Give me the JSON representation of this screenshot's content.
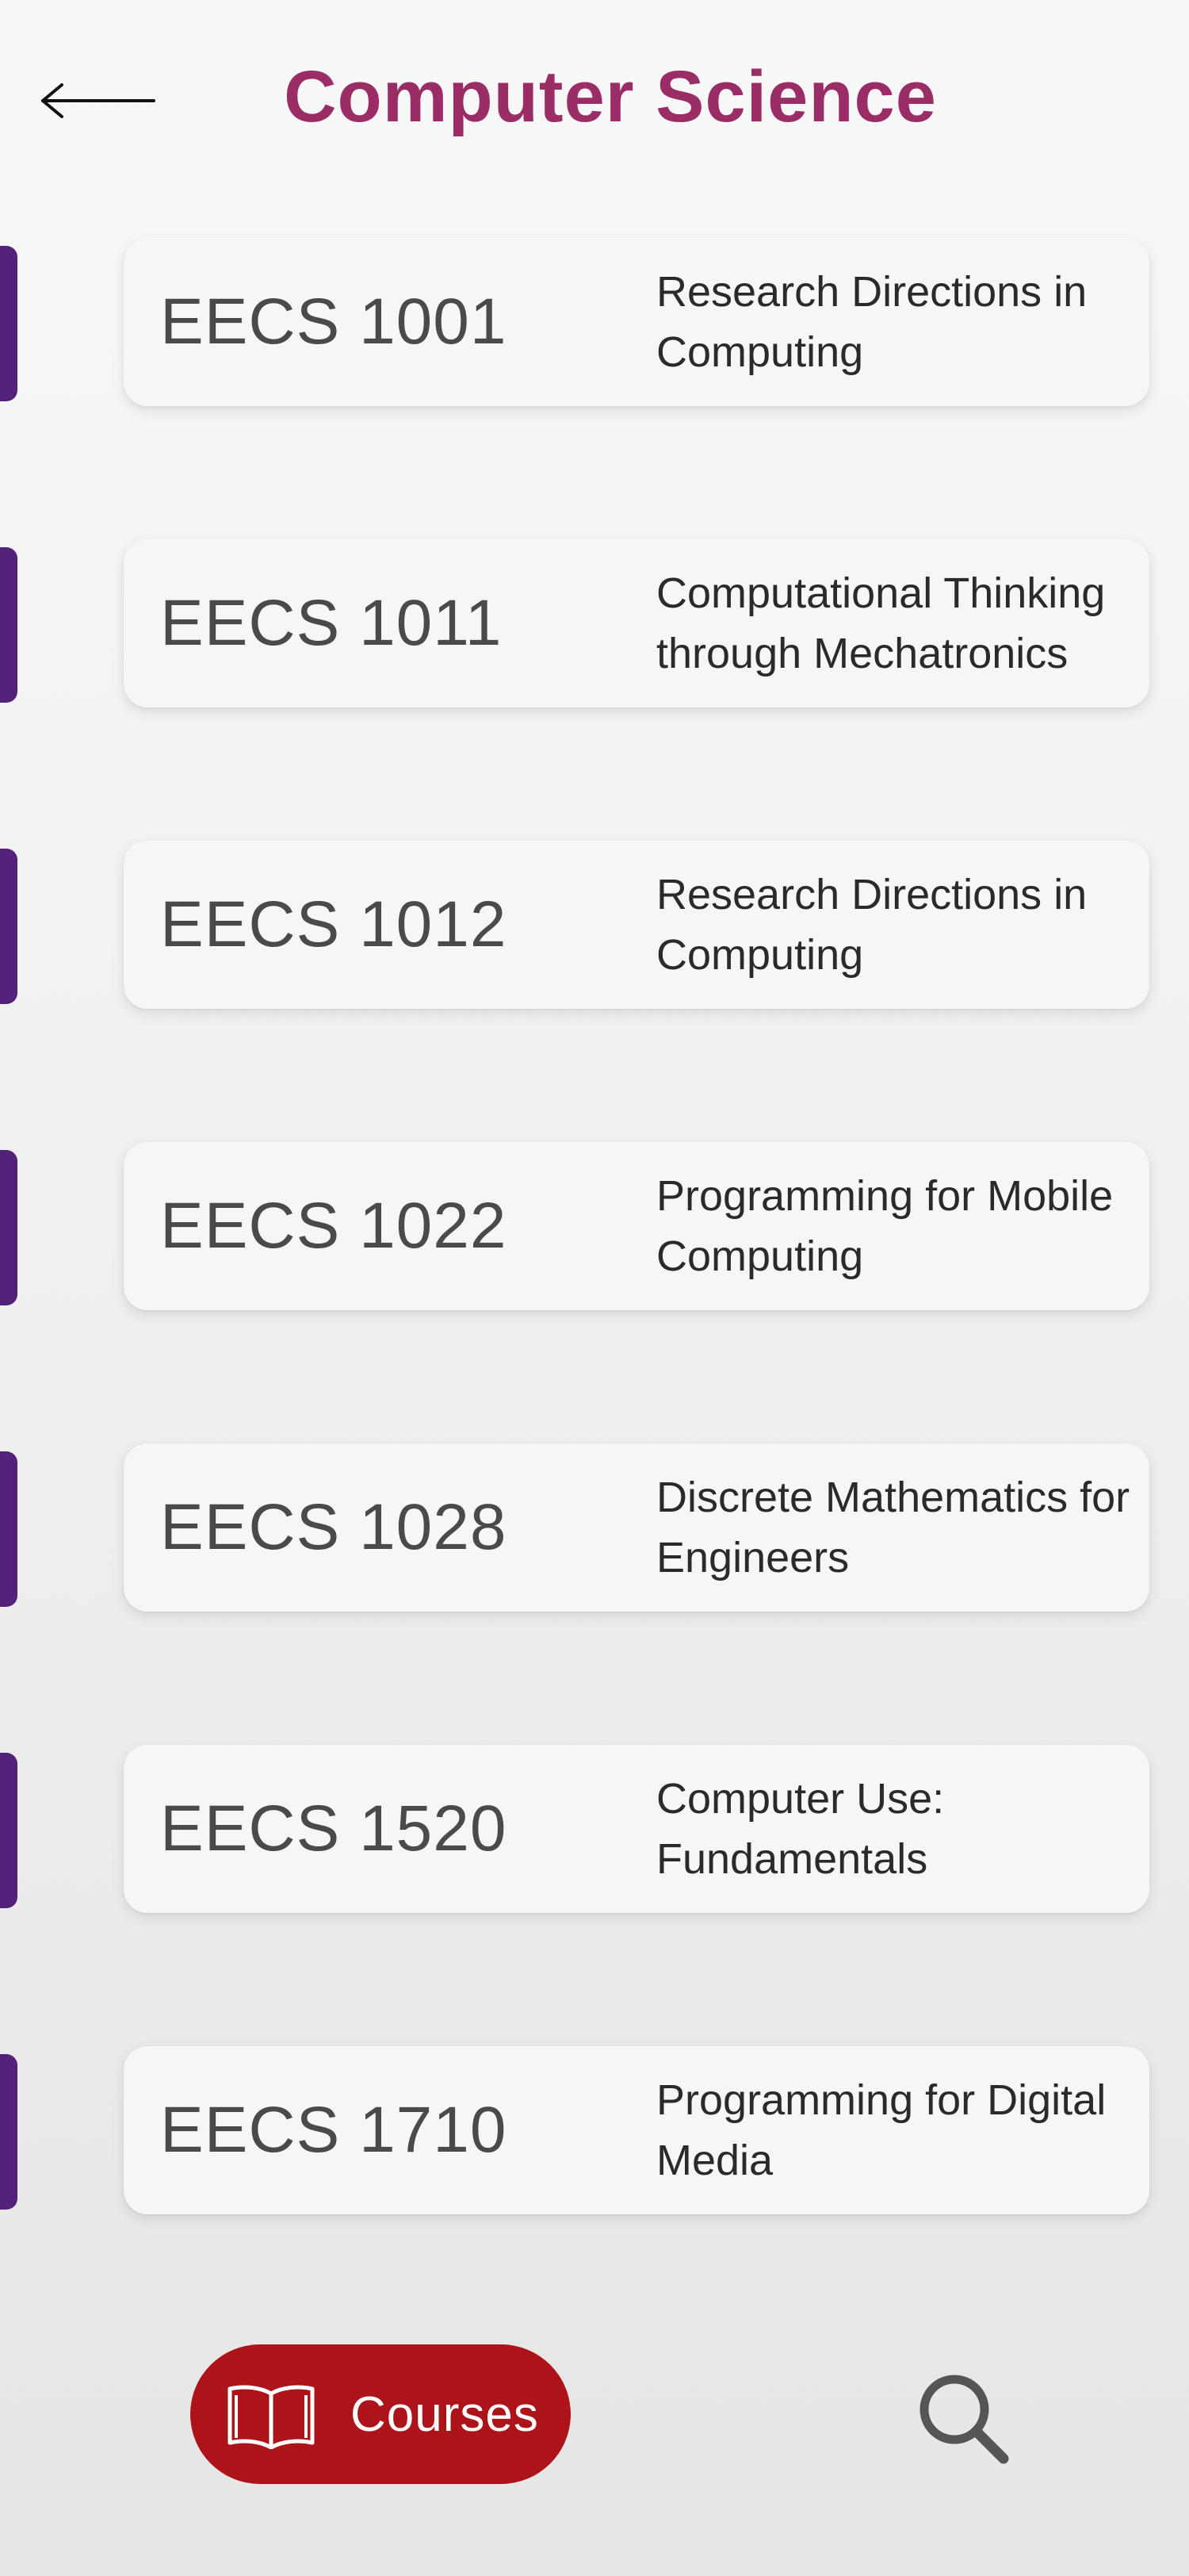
{
  "header": {
    "title": "Computer Science",
    "back_icon": "arrow-left-icon"
  },
  "colors": {
    "title": "#9b2d66",
    "accent_bar": "#52217a",
    "card_background": "#f6f6f6",
    "courses_tab": "#ad1419"
  },
  "courses": [
    {
      "code": "EECS 1001",
      "name": "Research Directions in Computing"
    },
    {
      "code": "EECS 1011",
      "name": "Computational Thinking through Mechatronics"
    },
    {
      "code": "EECS 1012",
      "name": "Research Directions in Computing"
    },
    {
      "code": "EECS 1022",
      "name": "Programming for Mobile Computing"
    },
    {
      "code": "EECS 1028",
      "name": "Discrete Mathematics for Engineers"
    },
    {
      "code": "EECS 1520",
      "name": "Computer Use: Fundamentals"
    },
    {
      "code": "EECS 1710",
      "name": "Programming for Digital Media"
    }
  ],
  "bottom_nav": {
    "courses_label": "Courses",
    "courses_icon": "book-icon",
    "search_icon": "search-icon"
  }
}
